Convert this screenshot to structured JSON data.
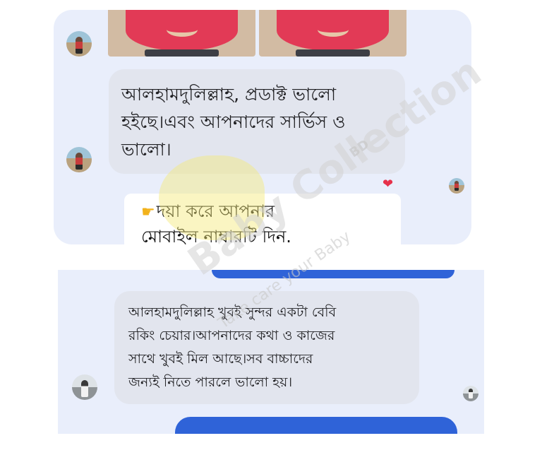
{
  "top_panel": {
    "message_1": {
      "lines": [
        "আলহামদুলিল্লাহ, প্রডাক্ট ভালো",
        "হইছে।এবং আপনাদের সার্ভিস ও",
        "ভালো।"
      ]
    },
    "reply_card": {
      "icon": "pointing-hand-icon",
      "lines": [
        "দয়া করে আপনার",
        "মোবাইল নাম্বারটি দিন."
      ]
    },
    "reaction": "heart-icon"
  },
  "bottom_panel": {
    "message_2": {
      "lines": [
        "আলহামদুলিল্লাহ খুবই সুন্দর একটা বেবি",
        "রকিং চেয়ার।আপনাদের কথা ও কাজের",
        "সাথে খুবই মিল আছে।সব বাচ্চাদের",
        "জন্যই নিতে পারলে ভালো হয়।"
      ]
    }
  },
  "watermark": {
    "brand": "Baby Collection",
    "badge": "BD",
    "tagline": "Take care your Baby"
  },
  "colors": {
    "panel_bg": "#e9eefb",
    "bubble_bg": "#e2e5ee",
    "sent_blue": "#2f63d8",
    "heart": "#e6314b"
  }
}
